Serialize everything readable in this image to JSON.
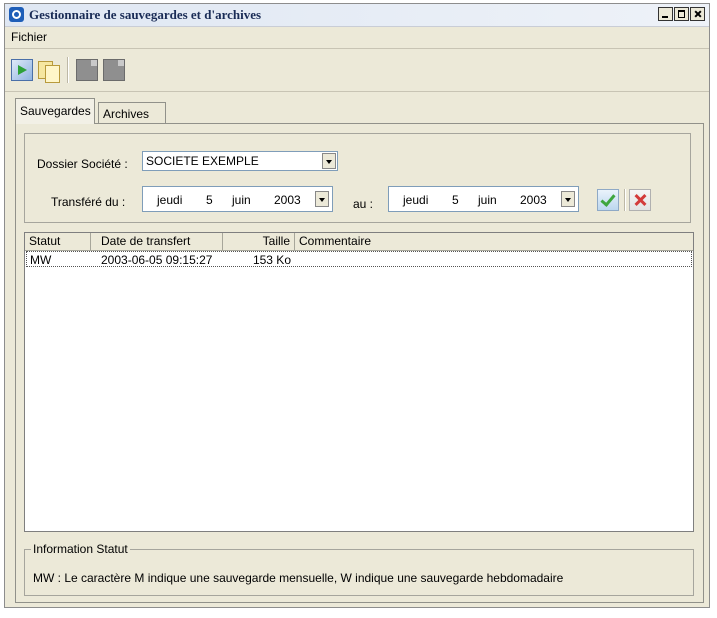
{
  "window": {
    "title": "Gestionnaire de sauvegardes et d'archives"
  },
  "menu": {
    "items": [
      "Fichier"
    ]
  },
  "tabs": [
    "Sauvegardes",
    "Archives"
  ],
  "filters": {
    "dossier_label": "Dossier Société :",
    "dossier_value": "SOCIETE EXEMPLE",
    "transfere_label": "Transféré du :",
    "from": {
      "day": "jeudi",
      "num": "5",
      "month": "juin",
      "year": "2003"
    },
    "au_label": "au :",
    "to": {
      "day": "jeudi",
      "num": "5",
      "month": "juin",
      "year": "2003"
    }
  },
  "table": {
    "columns": [
      "Statut",
      "Date de transfert",
      "Taille",
      "Commentaire"
    ],
    "rows": [
      {
        "statut": "MW",
        "date": "2003-06-05 09:15:27",
        "taille": "153 Ko",
        "commentaire": ""
      }
    ]
  },
  "info": {
    "legend": "Information Statut",
    "text": "MW : Le caractère M indique une sauvegarde mensuelle, W indique une sauvegarde hebdomadaire"
  }
}
